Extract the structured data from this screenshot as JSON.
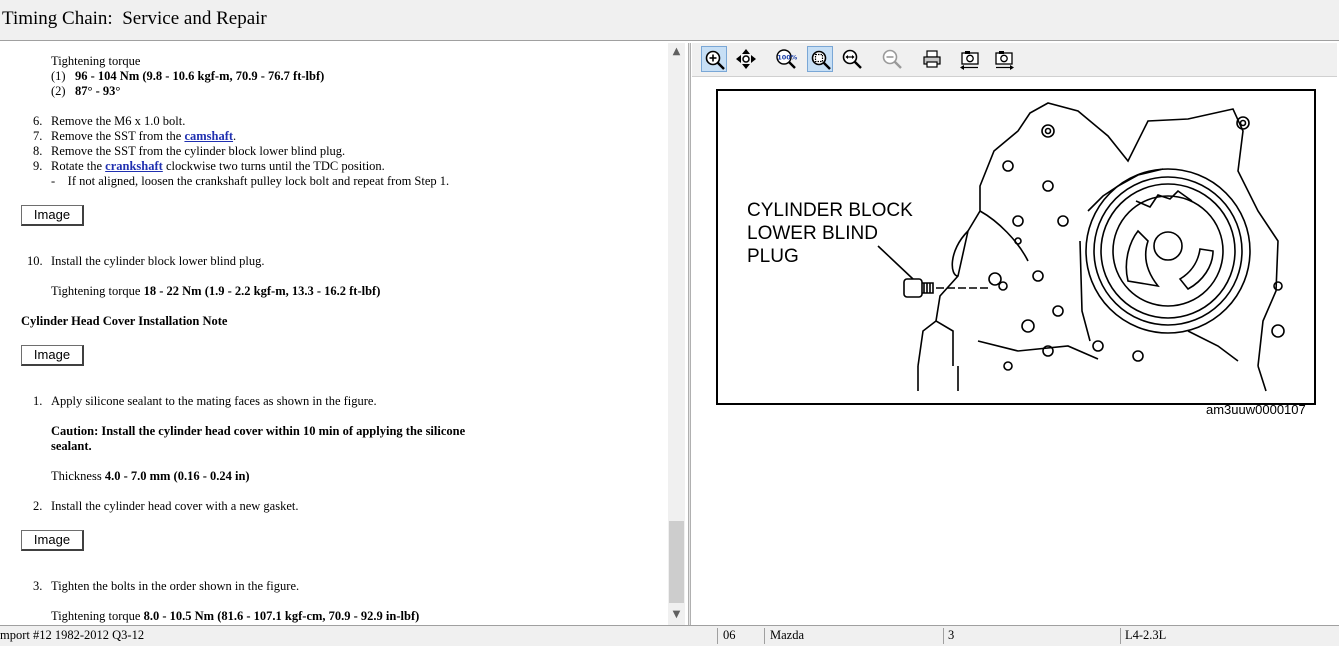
{
  "window": {
    "title": "Timing Chain:  Service and Repair"
  },
  "content": {
    "torque_heading": "Tightening torque",
    "torque1_num": "(1)",
    "torque1_val": "96 - 104 Nm (9.8 - 10.6 kgf-m, 70.9 - 76.7 ft-lbf)",
    "torque2_num": "(2)",
    "torque2_val": "87° - 93°",
    "step6_num": "6.",
    "step6": "Remove the M6 x 1.0 bolt.",
    "step7_num": "7.",
    "step7_pre": "Remove the SST from the ",
    "step7_link": "camshaft",
    "step7_post": ".",
    "step8_num": "8.",
    "step8": "Remove the SST from the cylinder block lower blind plug.",
    "step9_num": "9.",
    "step9_pre": "Rotate the ",
    "step9_link": "crankshaft",
    "step9_post": " clockwise two turns until the TDC position.",
    "step9_sub": "-    If not aligned, loosen the crankshaft pulley lock bolt and repeat from Step 1.",
    "image_button": "Image",
    "step10_num": "10.",
    "step10": "Install the cylinder block lower blind plug.",
    "step10_torque_label": "Tightening torque ",
    "step10_torque_val": "18 - 22 Nm (1.9 - 2.2 kgf-m, 13.3 - 16.2 ft-lbf)",
    "section_heading": "Cylinder Head Cover Installation Note",
    "s1_num": "1.",
    "s1": "Apply silicone sealant to the mating faces as shown in the figure.",
    "caution_line1": "Caution: Install the cylinder head cover within 10 min of applying the silicone",
    "caution_line2": "sealant.",
    "thickness_label": "Thickness ",
    "thickness_val": "4.0 - 7.0 mm (0.16 - 0.24 in)",
    "s2_num": "2.",
    "s2": "Install the cylinder head cover with a new gasket.",
    "s3_num": "3.",
    "s3": "Tighten the bolts in the order shown in the figure.",
    "s3_torque_label": "Tightening torque ",
    "s3_torque_val": "8.0 - 10.5 Nm (81.6 - 107.1 kgf-cm, 70.9 - 92.9 in-lbf)"
  },
  "toolbar": {
    "icons": [
      "zoom-in-icon",
      "pan-icon",
      "actual-size-icon",
      "fit-page-icon",
      "fit-width-icon",
      "zoom-out-icon",
      "print-icon",
      "previous-image-icon",
      "next-image-icon"
    ]
  },
  "figure": {
    "label_line1": "CYLINDER BLOCK",
    "label_line2": "LOWER BLIND",
    "label_line3": "PLUG",
    "id": "am3uuw0000107"
  },
  "statusbar": {
    "source": "mport #12 1982-2012 Q3-12",
    "year": "06",
    "make": "Mazda",
    "model": "3",
    "engine": "L4-2.3L"
  },
  "colors": {
    "link": "#1f2fb0",
    "chrome": "#f0f0f0"
  }
}
